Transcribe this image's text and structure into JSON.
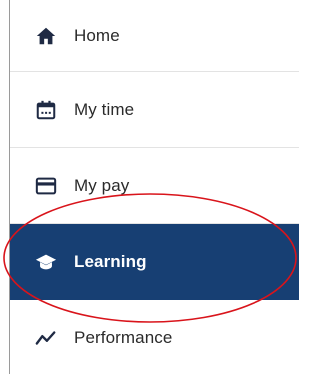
{
  "nav": {
    "items": [
      {
        "label": "Home",
        "icon": "home-icon",
        "active": false
      },
      {
        "label": "My time",
        "icon": "calendar-icon",
        "active": false
      },
      {
        "label": "My pay",
        "icon": "credit-card-icon",
        "active": false
      },
      {
        "label": "Learning",
        "icon": "graduation-cap-icon",
        "active": true
      },
      {
        "label": "Performance",
        "icon": "trend-line-icon",
        "active": false
      }
    ]
  },
  "colors": {
    "active_background": "#173f73",
    "icon_color": "#1f2a44",
    "annotation_circle": "#d9141b"
  }
}
